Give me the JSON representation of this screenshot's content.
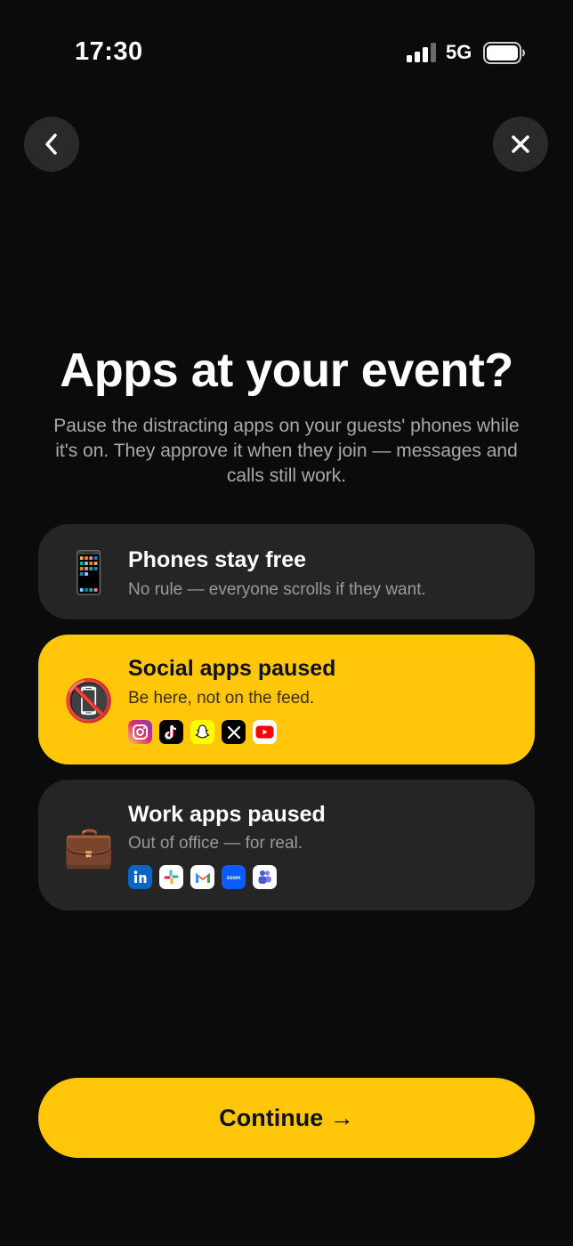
{
  "status_bar": {
    "time": "17:30",
    "network": "5G",
    "icons": [
      "signal-icon",
      "battery-icon"
    ]
  },
  "nav": {
    "back_icon": "chevron-left-icon",
    "close_icon": "close-icon"
  },
  "header": {
    "title": "Apps at your event?",
    "subtitle": "Pause the distracting apps on your guests' phones while it's on. They approve it when they join — messages and calls still work."
  },
  "options": [
    {
      "title": "Phones stay free",
      "description": "No rule — everyone scrolls if they want.",
      "emoji": "📱",
      "selected": false,
      "apps": []
    },
    {
      "title": "Social apps paused",
      "description": "Be here, not on the feed.",
      "emoji": "📵",
      "selected": true,
      "apps": [
        "instagram-icon",
        "tiktok-icon",
        "snapchat-icon",
        "x-icon",
        "youtube-icon"
      ]
    },
    {
      "title": "Work apps paused",
      "description": "Out of office — for real.",
      "emoji": "💼",
      "selected": false,
      "apps": [
        "linkedin-icon",
        "slack-icon",
        "gmail-icon",
        "zoom-icon",
        "teams-icon"
      ]
    }
  ],
  "continue_label": "Continue →",
  "colors": {
    "background": "#0b0b0b",
    "accent": "#ffc60a",
    "card": "#252525"
  }
}
